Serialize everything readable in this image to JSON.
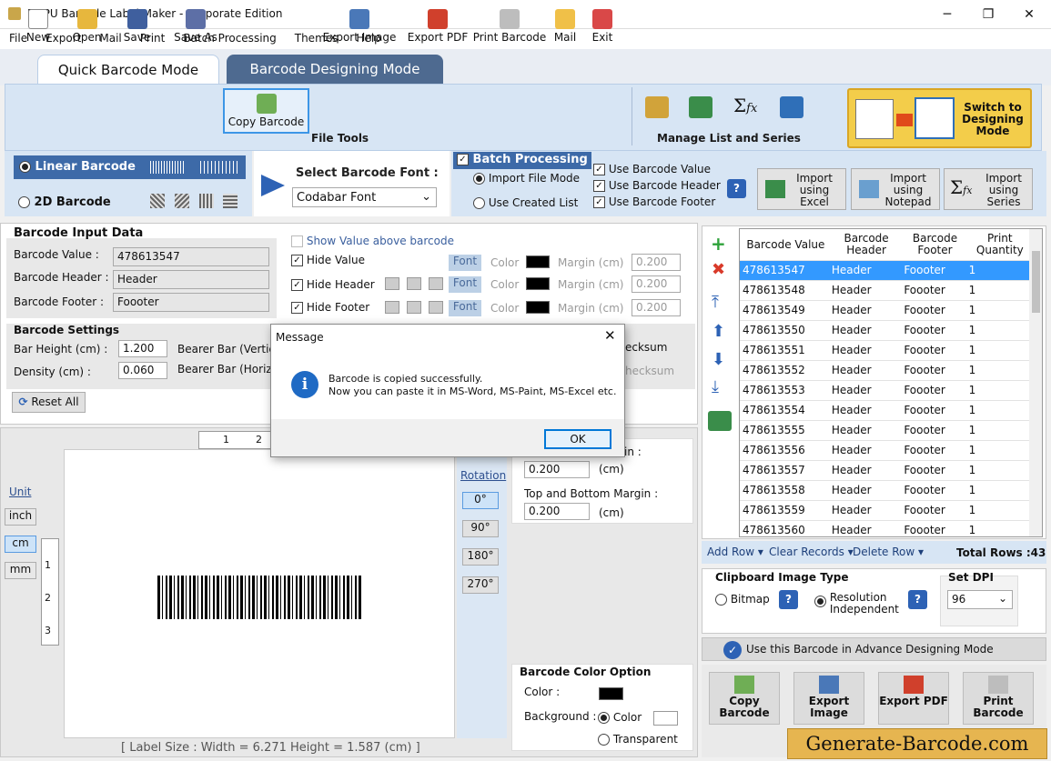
{
  "window": {
    "title": "DRPU Barcode Label Maker - Corporate Edition"
  },
  "menu": [
    "File",
    "Export",
    "Mail",
    "Print",
    "Batch Processing",
    "Themes",
    "Help"
  ],
  "tabs": {
    "quick": "Quick Barcode Mode",
    "designing": "Barcode Designing Mode"
  },
  "toolbar": {
    "new": "New",
    "open": "Open",
    "save": "Save",
    "save_as": "Save As",
    "copy_barcode": "Copy Barcode",
    "export_image": "Export Image",
    "export_pdf": "Export PDF",
    "print_barcode": "Print Barcode",
    "mail": "Mail",
    "exit": "Exit",
    "file_tools": "File Tools",
    "manage_list": "Manage List and Series",
    "switch": "Switch to Designing Mode"
  },
  "barcode_type": {
    "linear": "Linear Barcode",
    "twod": "2D Barcode"
  },
  "font": {
    "label": "Select Barcode Font :",
    "value": "Codabar Font"
  },
  "batch": {
    "title": "Batch Processing",
    "import_file": "Import File Mode",
    "use_created": "Use Created List",
    "use_value": "Use Barcode Value",
    "use_header": "Use Barcode Header",
    "use_footer": "Use Barcode Footer",
    "import_excel": "Import using Excel",
    "import_notepad": "Import using Notepad",
    "import_series": "Import using Series"
  },
  "input": {
    "title": "Barcode Input Data",
    "value_label": "Barcode Value :",
    "value": "478613547",
    "header_label": "Barcode Header :",
    "header": "Header",
    "footer_label": "Barcode Footer :",
    "footer": "Foooter"
  },
  "show_value_above": "Show Value above barcode",
  "hide": {
    "value": "Hide Value",
    "header": "Hide Header",
    "footer": "Hide Footer",
    "font": "Font",
    "color": "Color",
    "margin": "Margin (cm)",
    "m1": "0.200",
    "m2": "0.200",
    "m3": "0.200"
  },
  "settings": {
    "title": "Barcode Settings",
    "bar_height_label": "Bar Height (cm) :",
    "bar_height": "1.200",
    "density_label": "Density (cm) :",
    "density": "0.060",
    "bearer_v": "Bearer Bar (Vertic",
    "bearer_h": "Bearer Bar (Horiz",
    "checksum1": "ecksum",
    "checksum2": "hecksum",
    "reset": "Reset All"
  },
  "units": {
    "label": "Unit",
    "inch": "inch",
    "cm": "cm",
    "mm": "mm"
  },
  "ruler": {
    "h": [
      "1",
      "2"
    ],
    "v": [
      "1",
      "2",
      "3"
    ]
  },
  "rotation": {
    "label": "Rotation",
    "r0": "0°",
    "r90": "90°",
    "r180": "180°",
    "r270": "270°"
  },
  "margins": {
    "lr_partial": "in :",
    "lr_value": "0.200",
    "unit": "(cm)",
    "tb_label": "Top and Bottom Margin :",
    "tb_value": "0.200"
  },
  "color_option": {
    "title": "Barcode Color Option",
    "color": "Color :",
    "background": "Background :",
    "color_radio": "Color",
    "transparent": "Transparent"
  },
  "label_size": "[ Label Size : Width = 6.271  Height = 1.587 (cm) ]",
  "grid": {
    "headers": [
      "Barcode Value",
      "Barcode Header",
      "Barcode Footer",
      "Print Quantity"
    ],
    "rows": [
      [
        "478613547",
        "Header",
        "Foooter",
        "1"
      ],
      [
        "478613548",
        "Header",
        "Foooter",
        "1"
      ],
      [
        "478613549",
        "Header",
        "Foooter",
        "1"
      ],
      [
        "478613550",
        "Header",
        "Foooter",
        "1"
      ],
      [
        "478613551",
        "Header",
        "Foooter",
        "1"
      ],
      [
        "478613552",
        "Header",
        "Foooter",
        "1"
      ],
      [
        "478613553",
        "Header",
        "Foooter",
        "1"
      ],
      [
        "478613554",
        "Header",
        "Foooter",
        "1"
      ],
      [
        "478613555",
        "Header",
        "Foooter",
        "1"
      ],
      [
        "478613556",
        "Header",
        "Foooter",
        "1"
      ],
      [
        "478613557",
        "Header",
        "Foooter",
        "1"
      ],
      [
        "478613558",
        "Header",
        "Foooter",
        "1"
      ],
      [
        "478613559",
        "Header",
        "Foooter",
        "1"
      ],
      [
        "478613560",
        "Header",
        "Foooter",
        "1"
      ]
    ],
    "add_row": "Add Row",
    "clear": "Clear Records",
    "delete": "Delete Row",
    "total": "Total Rows :43"
  },
  "clipboard": {
    "title": "Clipboard Image Type",
    "bitmap": "Bitmap",
    "resolution": "Resolution Independent",
    "dpi_title": "Set DPI",
    "dpi": "96"
  },
  "advance": "Use this Barcode in Advance Designing Mode",
  "bottom_buttons": {
    "copy": "Copy Barcode",
    "export_image": "Export Image",
    "export_pdf": "Export PDF",
    "print": "Print Barcode"
  },
  "watermark": "Generate-Barcode.com",
  "dialog": {
    "title": "Message",
    "line1": "Barcode is copied successfully.",
    "line2": "Now you can paste it in MS-Word, MS-Paint, MS-Excel etc.",
    "ok": "OK"
  }
}
